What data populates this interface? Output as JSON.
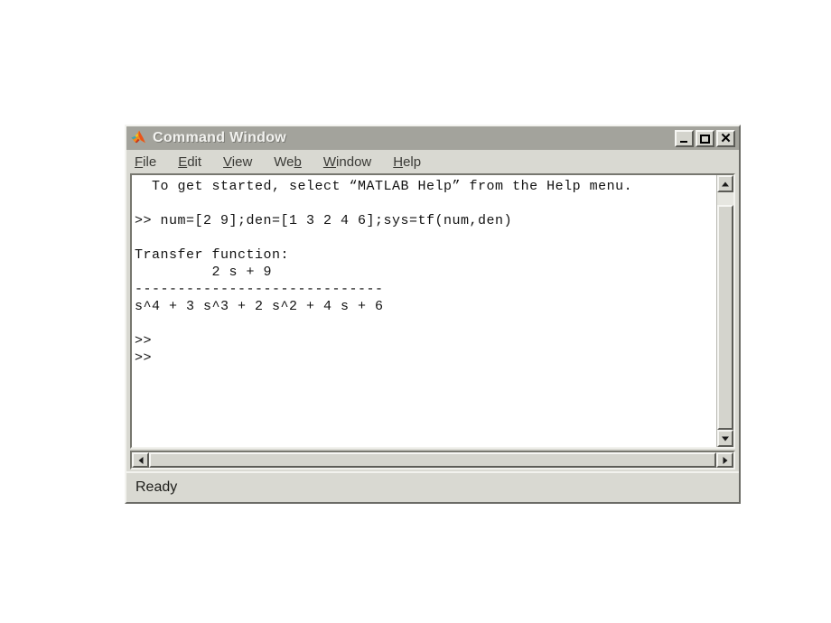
{
  "window": {
    "title": "Command Window",
    "logo_icon": "matlab-membrane-logo-icon",
    "controls": {
      "minimize": "_",
      "maximize": "□",
      "close": "×"
    }
  },
  "menubar": {
    "items": [
      {
        "label": "File",
        "pre": "",
        "mnemonic": "F",
        "post": "ile"
      },
      {
        "label": "Edit",
        "pre": "",
        "mnemonic": "E",
        "post": "dit"
      },
      {
        "label": "View",
        "pre": "",
        "mnemonic": "V",
        "post": "iew"
      },
      {
        "label": "Web",
        "pre": "We",
        "mnemonic": "b",
        "post": ""
      },
      {
        "label": "Window",
        "pre": "",
        "mnemonic": "W",
        "post": "indow"
      },
      {
        "label": "Help",
        "pre": "",
        "mnemonic": "H",
        "post": "elp"
      }
    ]
  },
  "console": {
    "lines": [
      "  To get started, select “MATLAB Help” from the Help menu.",
      "",
      ">> num=[2 9];den=[1 3 2 4 6];sys=tf(num,den)",
      "",
      "Transfer function:",
      "         2 s + 9",
      "-----------------------------",
      "s^4 + 3 s^3 + 2 s^2 + 4 s + 6",
      "",
      ">>",
      ">>"
    ]
  },
  "scrollbars": {
    "vertical": {
      "up_icon": "triangle-up-icon",
      "down_icon": "triangle-down-icon"
    },
    "horizontal": {
      "left_icon": "triangle-left-icon",
      "right_icon": "triangle-right-icon"
    }
  },
  "statusbar": {
    "text": "Ready"
  },
  "colors": {
    "page_background": "#ffffff",
    "window_face": "#d9d9d2",
    "titlebar": "#a3a39c",
    "titlebar_text": "#f2f2ef",
    "console_background": "#ffffff",
    "console_text": "#121212"
  }
}
